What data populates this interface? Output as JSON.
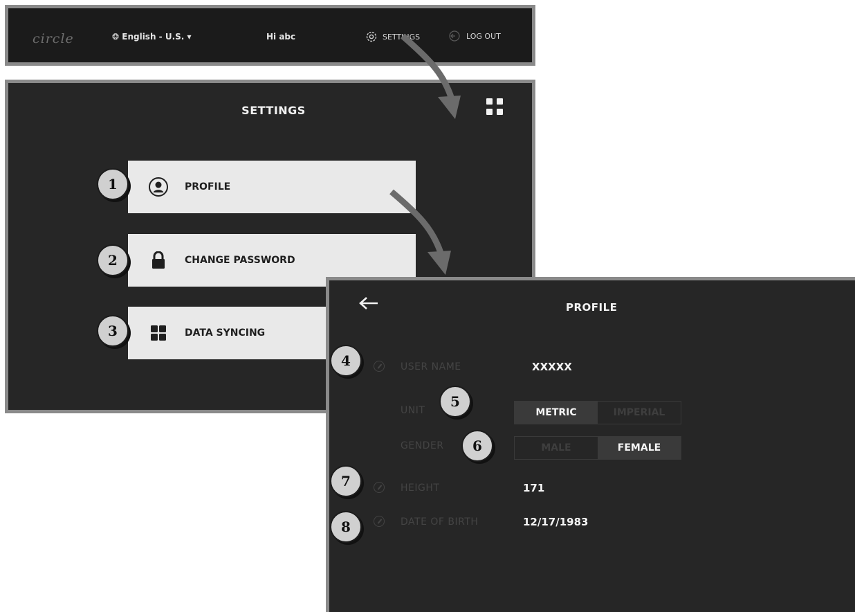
{
  "topbar": {
    "logo": "circle",
    "language": "English - U.S.",
    "greeting": "Hi abc",
    "settings_label": "SETTINGS",
    "logout_label": "LOG OUT"
  },
  "settings": {
    "title": "SETTINGS",
    "items": [
      {
        "label": "PROFILE",
        "icon": "user-circle-icon",
        "callout": "1"
      },
      {
        "label": "CHANGE PASSWORD",
        "icon": "lock-icon",
        "callout": "2"
      },
      {
        "label": "DATA SYNCING",
        "icon": "grid-icon",
        "callout": "3"
      }
    ]
  },
  "profile": {
    "title": "PROFILE",
    "user_name_label": "USER NAME",
    "user_name": "XXXXX",
    "unit_label": "UNIT",
    "unit_options": [
      "METRIC",
      "IMPERIAL"
    ],
    "unit_selected": "METRIC",
    "gender_label": "GENDER",
    "gender_options": [
      "MALE",
      "FEMALE"
    ],
    "gender_selected": "FEMALE",
    "height_label": "HEIGHT",
    "height": "171",
    "dob_label": "DATE OF BIRTH",
    "dob": "12/17/1983",
    "callouts": [
      "4",
      "5",
      "6",
      "7",
      "8"
    ]
  },
  "colors": {
    "panel_bg": "#262626",
    "panel_border": "#8a8a8a",
    "menu_item_bg": "#e9e9e9",
    "callout_bg": "#d0d0d0",
    "arrow": "#6b6b6b"
  }
}
